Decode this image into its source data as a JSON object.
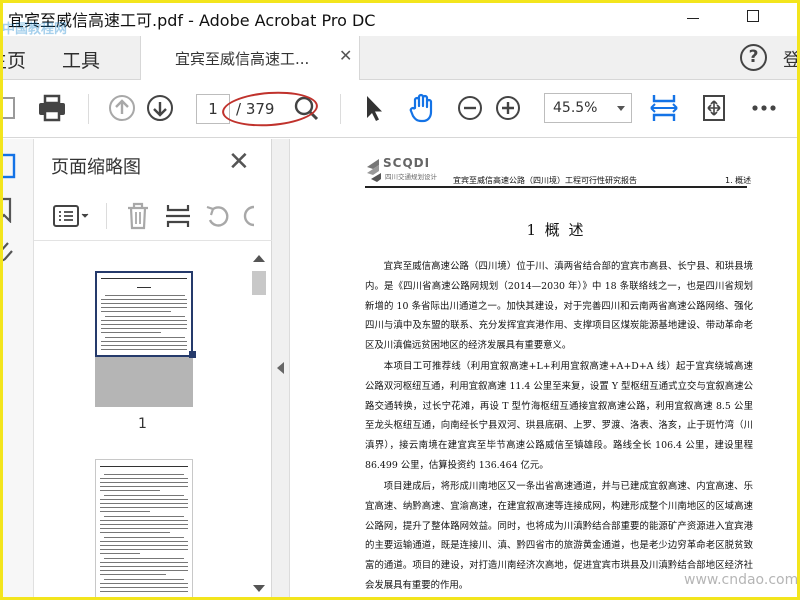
{
  "window": {
    "title": "宜宾至威信高速工可.pdf - Adobe Acrobat Pro DC",
    "watermark": "中国教程网"
  },
  "menubar": {
    "home_label": "主页",
    "tools_label": "工具",
    "document_tab_label": "宜宾至威信高速工...",
    "signin_label": "登"
  },
  "toolbar": {
    "current_page": "1",
    "total_pages": "/ 379",
    "zoom": "45.5%"
  },
  "thumbnail_panel": {
    "title": "页面缩略图",
    "page_number": "1"
  },
  "document": {
    "header_title": "宜宾至威信高速公路（四川境）工程可行性研究报告",
    "header_section": "1. 概述",
    "logo_text": "SCQDI",
    "logo_subtext": "四川交通规划设计",
    "chapter_title": "1 概 述",
    "paragraphs": [
      "宜宾至威信高速公路（四川境）位于川、滇两省结合部的宜宾市高县、长宁县、和珙县境内。是《四川省高速公路网规划（2014—2030 年）》中 18 条联络线之一，也是四川省规划新增的 10 条省际出川通道之一。加快其建设，对于完善四川和云南两省高速公路网络、强化四川与滇中及东盟的联系、充分发挥宜宾港作用、支撑项目区煤炭能源基地建设、带动革命老区及川滇偏远贫困地区的经济发展具有重要意义。",
      "本项目工可推荐线（利用宜叙高速+L+利用宜叙高速+A+D+A 线）起于宜宾绕城高速公路双河枢纽互通，利用宜叙高速 11.4 公里至来复，设置 Y 型枢纽互通式立交与宜叙高速公路交通转换，过长宁花滩，再设 T 型竹海枢纽互通接宜叙高速公路，利用宜叙高速 8.5 公里至龙头枢纽互通，向南经长宁县双河、珙县底硐、上罗、罗渡、洛表、洛亥，止于斑竹湾（川滇界），接云南境在建宜宾至毕节高速公路威信至镇雄段。路线全长 106.4 公里，建设里程 86.499 公里，估算投资约 136.464 亿元。",
      "项目建成后，将形成川南地区又一条出省高速通道，并与已建成宜叙高速、内宜高速、乐宜高速、纳黔高速、宜渝高速，在建宜叙高速等连接成网，构建形成整个川南地区的区域高速公路网，提升了整体路网效益。同时，也将成为川滇黔结合部重要的能源矿产资源进入宜宾港的主要运输通道，既是连接川、滇、黔四省市的旅游黄金通道，也是老少边穷革命老区脱贫致富的通道。项目的建设，对打造川南经济次高地，促进宜宾市珙县及川滇黔结合部地区经济社会发展具有重要的作用。"
    ],
    "corner_watermark": "www.cndao.com"
  },
  "colors": {
    "frame": "#f3e51d",
    "annotation_circle": "#c0322c",
    "acrobat_blue": "#1473e6",
    "thumb_selection": "#253a6b"
  }
}
